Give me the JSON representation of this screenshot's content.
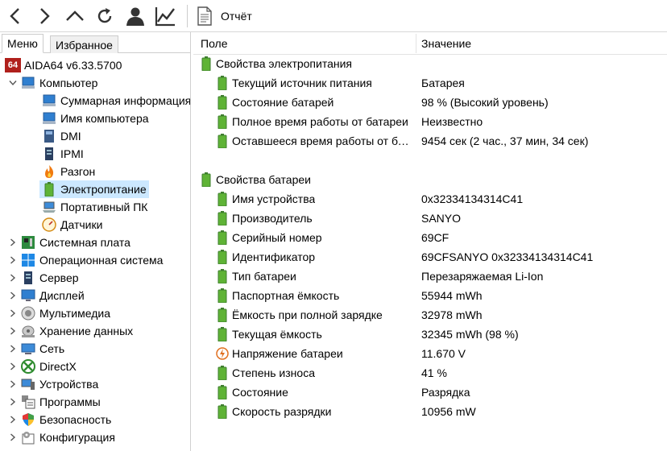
{
  "toolbar": {
    "report_label": "Отчёт"
  },
  "tabs": {
    "menu": "Меню",
    "favorites": "Избранное"
  },
  "tree": {
    "root": "AIDA64 v6.33.5700",
    "root_badge": "64",
    "computer": "Компьютер",
    "computer_children": [
      "Суммарная информация",
      "Имя компьютера",
      "DMI",
      "IPMI",
      "Разгон",
      "Электропитание",
      "Портативный ПК",
      "Датчики"
    ],
    "top_items": [
      "Системная плата",
      "Операционная система",
      "Сервер",
      "Дисплей",
      "Мультимедиа",
      "Хранение данных",
      "Сеть",
      "DirectX",
      "Устройства",
      "Программы",
      "Безопасность",
      "Конфигурация"
    ]
  },
  "columns": {
    "field": "Поле",
    "value": "Значение"
  },
  "power": {
    "title": "Свойства электропитания",
    "rows": [
      {
        "field": "Текущий источник питания",
        "value": "Батарея"
      },
      {
        "field": "Состояние батарей",
        "value": "98 % (Высокий уровень)"
      },
      {
        "field": "Полное время работы от батареи",
        "value": "Неизвестно"
      },
      {
        "field": "Оставшееся время работы от батареи",
        "value": "9454 сек (2 час., 37 мин, 34 сек)"
      }
    ]
  },
  "battery": {
    "title": "Свойства батареи",
    "rows": [
      {
        "field": "Имя устройства",
        "value": "0x32334134314C41"
      },
      {
        "field": "Производитель",
        "value": "SANYO"
      },
      {
        "field": "Серийный номер",
        "value": "69CF"
      },
      {
        "field": "Идентификатор",
        "value": "69CFSANYO 0x32334134314C41"
      },
      {
        "field": "Тип батареи",
        "value": "Перезаряжаемая Li-Ion"
      },
      {
        "field": "Паспортная ёмкость",
        "value": "55944 mWh"
      },
      {
        "field": "Ёмкость при полной зарядке",
        "value": "32978 mWh"
      },
      {
        "field": "Текущая ёмкость",
        "value": "32345 mWh  (98 %)"
      },
      {
        "field": "Напряжение батареи",
        "value": "11.670 V"
      },
      {
        "field": "Степень износа",
        "value": "41 %"
      },
      {
        "field": "Состояние",
        "value": "Разрядка"
      },
      {
        "field": "Скорость разрядки",
        "value": "10956 mW"
      }
    ]
  }
}
